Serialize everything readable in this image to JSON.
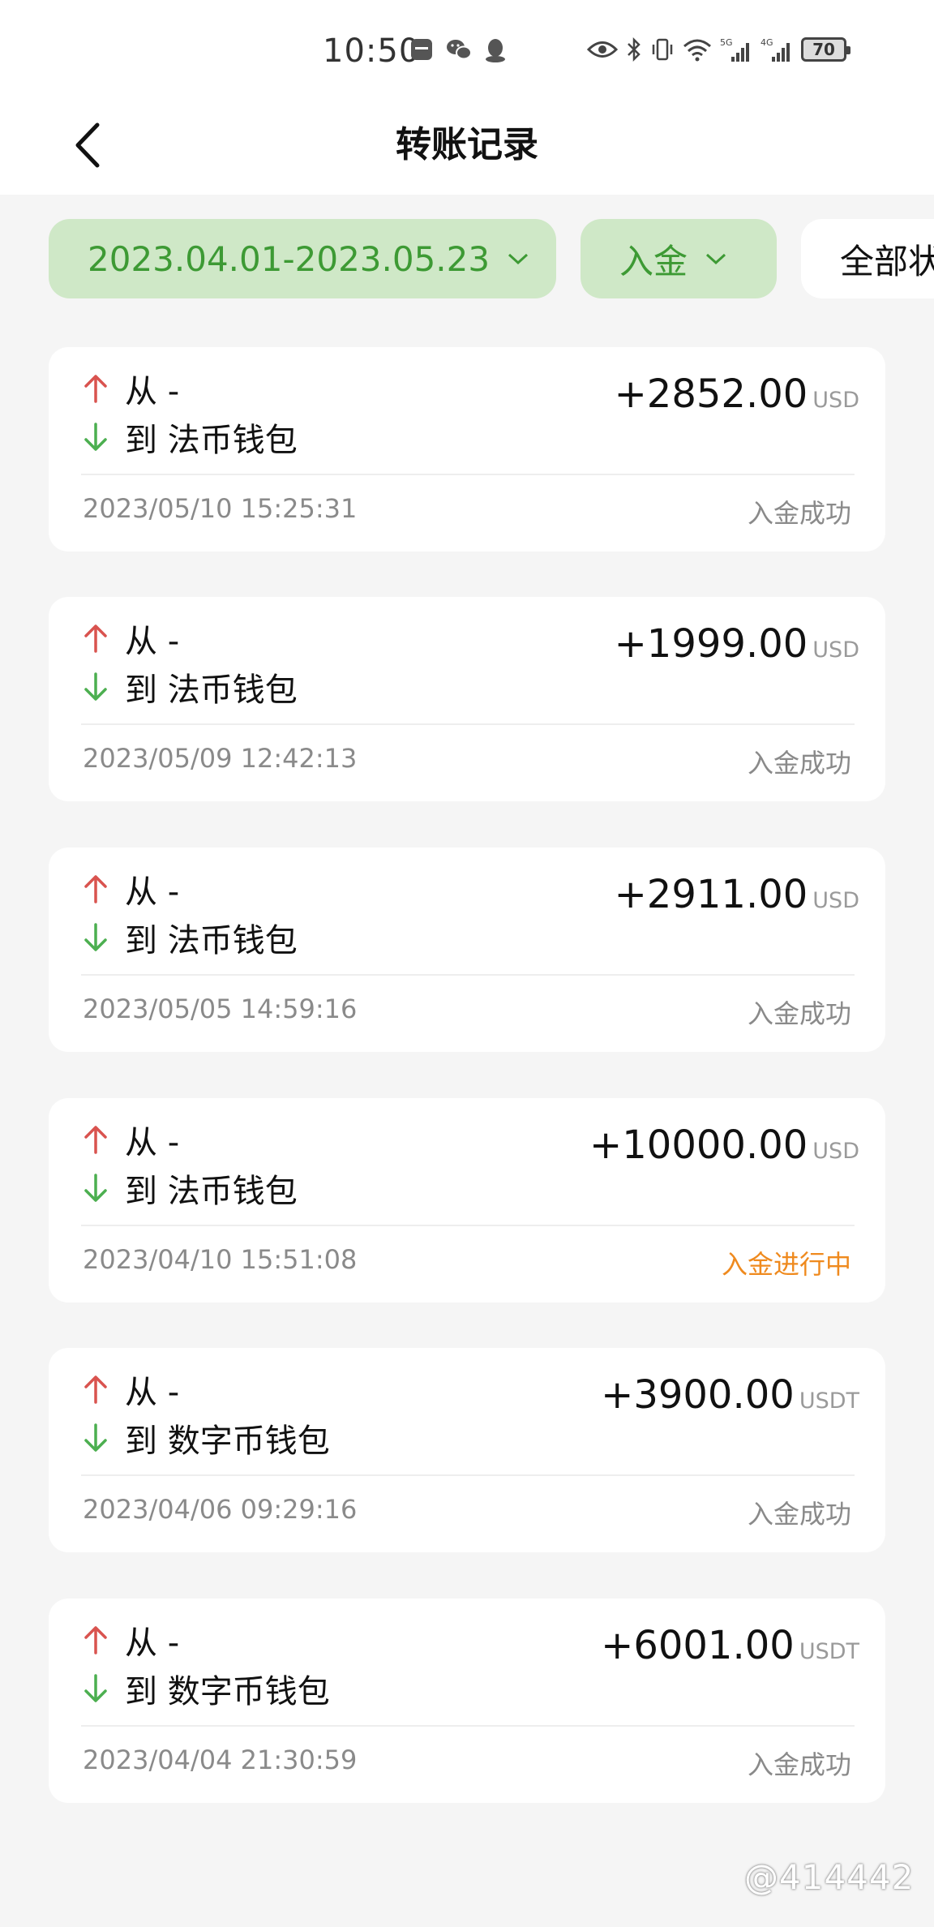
{
  "status_bar": {
    "time": "10:50",
    "battery": "70",
    "network_5g": "5G",
    "network_4g": "4G"
  },
  "header": {
    "title": "转账记录"
  },
  "filters": {
    "date_range": "2023.04.01-2023.05.23",
    "type": "入金",
    "status": "全部状态"
  },
  "records": [
    {
      "from": "从 -",
      "to": "到 法币钱包",
      "amount": "+2852.00",
      "currency": "USD",
      "datetime": "2023/05/10 15:25:31",
      "status": "入金成功"
    },
    {
      "from": "从 -",
      "to": "到 法币钱包",
      "amount": "+1999.00",
      "currency": "USD",
      "datetime": "2023/05/09 12:42:13",
      "status": "入金成功"
    },
    {
      "from": "从 -",
      "to": "到 法币钱包",
      "amount": "+2911.00",
      "currency": "USD",
      "datetime": "2023/05/05 14:59:16",
      "status": "入金成功"
    },
    {
      "from": "从 -",
      "to": "到 法币钱包",
      "amount": "+10000.00",
      "currency": "USD",
      "datetime": "2023/04/10 15:51:08",
      "status": "入金进行中"
    },
    {
      "from": "从 -",
      "to": "到 数字币钱包",
      "amount": "+3900.00",
      "currency": "USDT",
      "datetime": "2023/04/06 09:29:16",
      "status": "入金成功"
    },
    {
      "from": "从 -",
      "to": "到 数字币钱包",
      "amount": "+6001.00",
      "currency": "USDT",
      "datetime": "2023/04/04 21:30:59",
      "status": "入金成功"
    }
  ],
  "watermark": "@414442",
  "colors": {
    "accent_green": "#3d9a34",
    "chip_green_bg": "#cfe8c7",
    "arrow_up_red": "#d9534f",
    "arrow_down_green": "#4caf50",
    "pending_orange": "#ef8a1e"
  }
}
